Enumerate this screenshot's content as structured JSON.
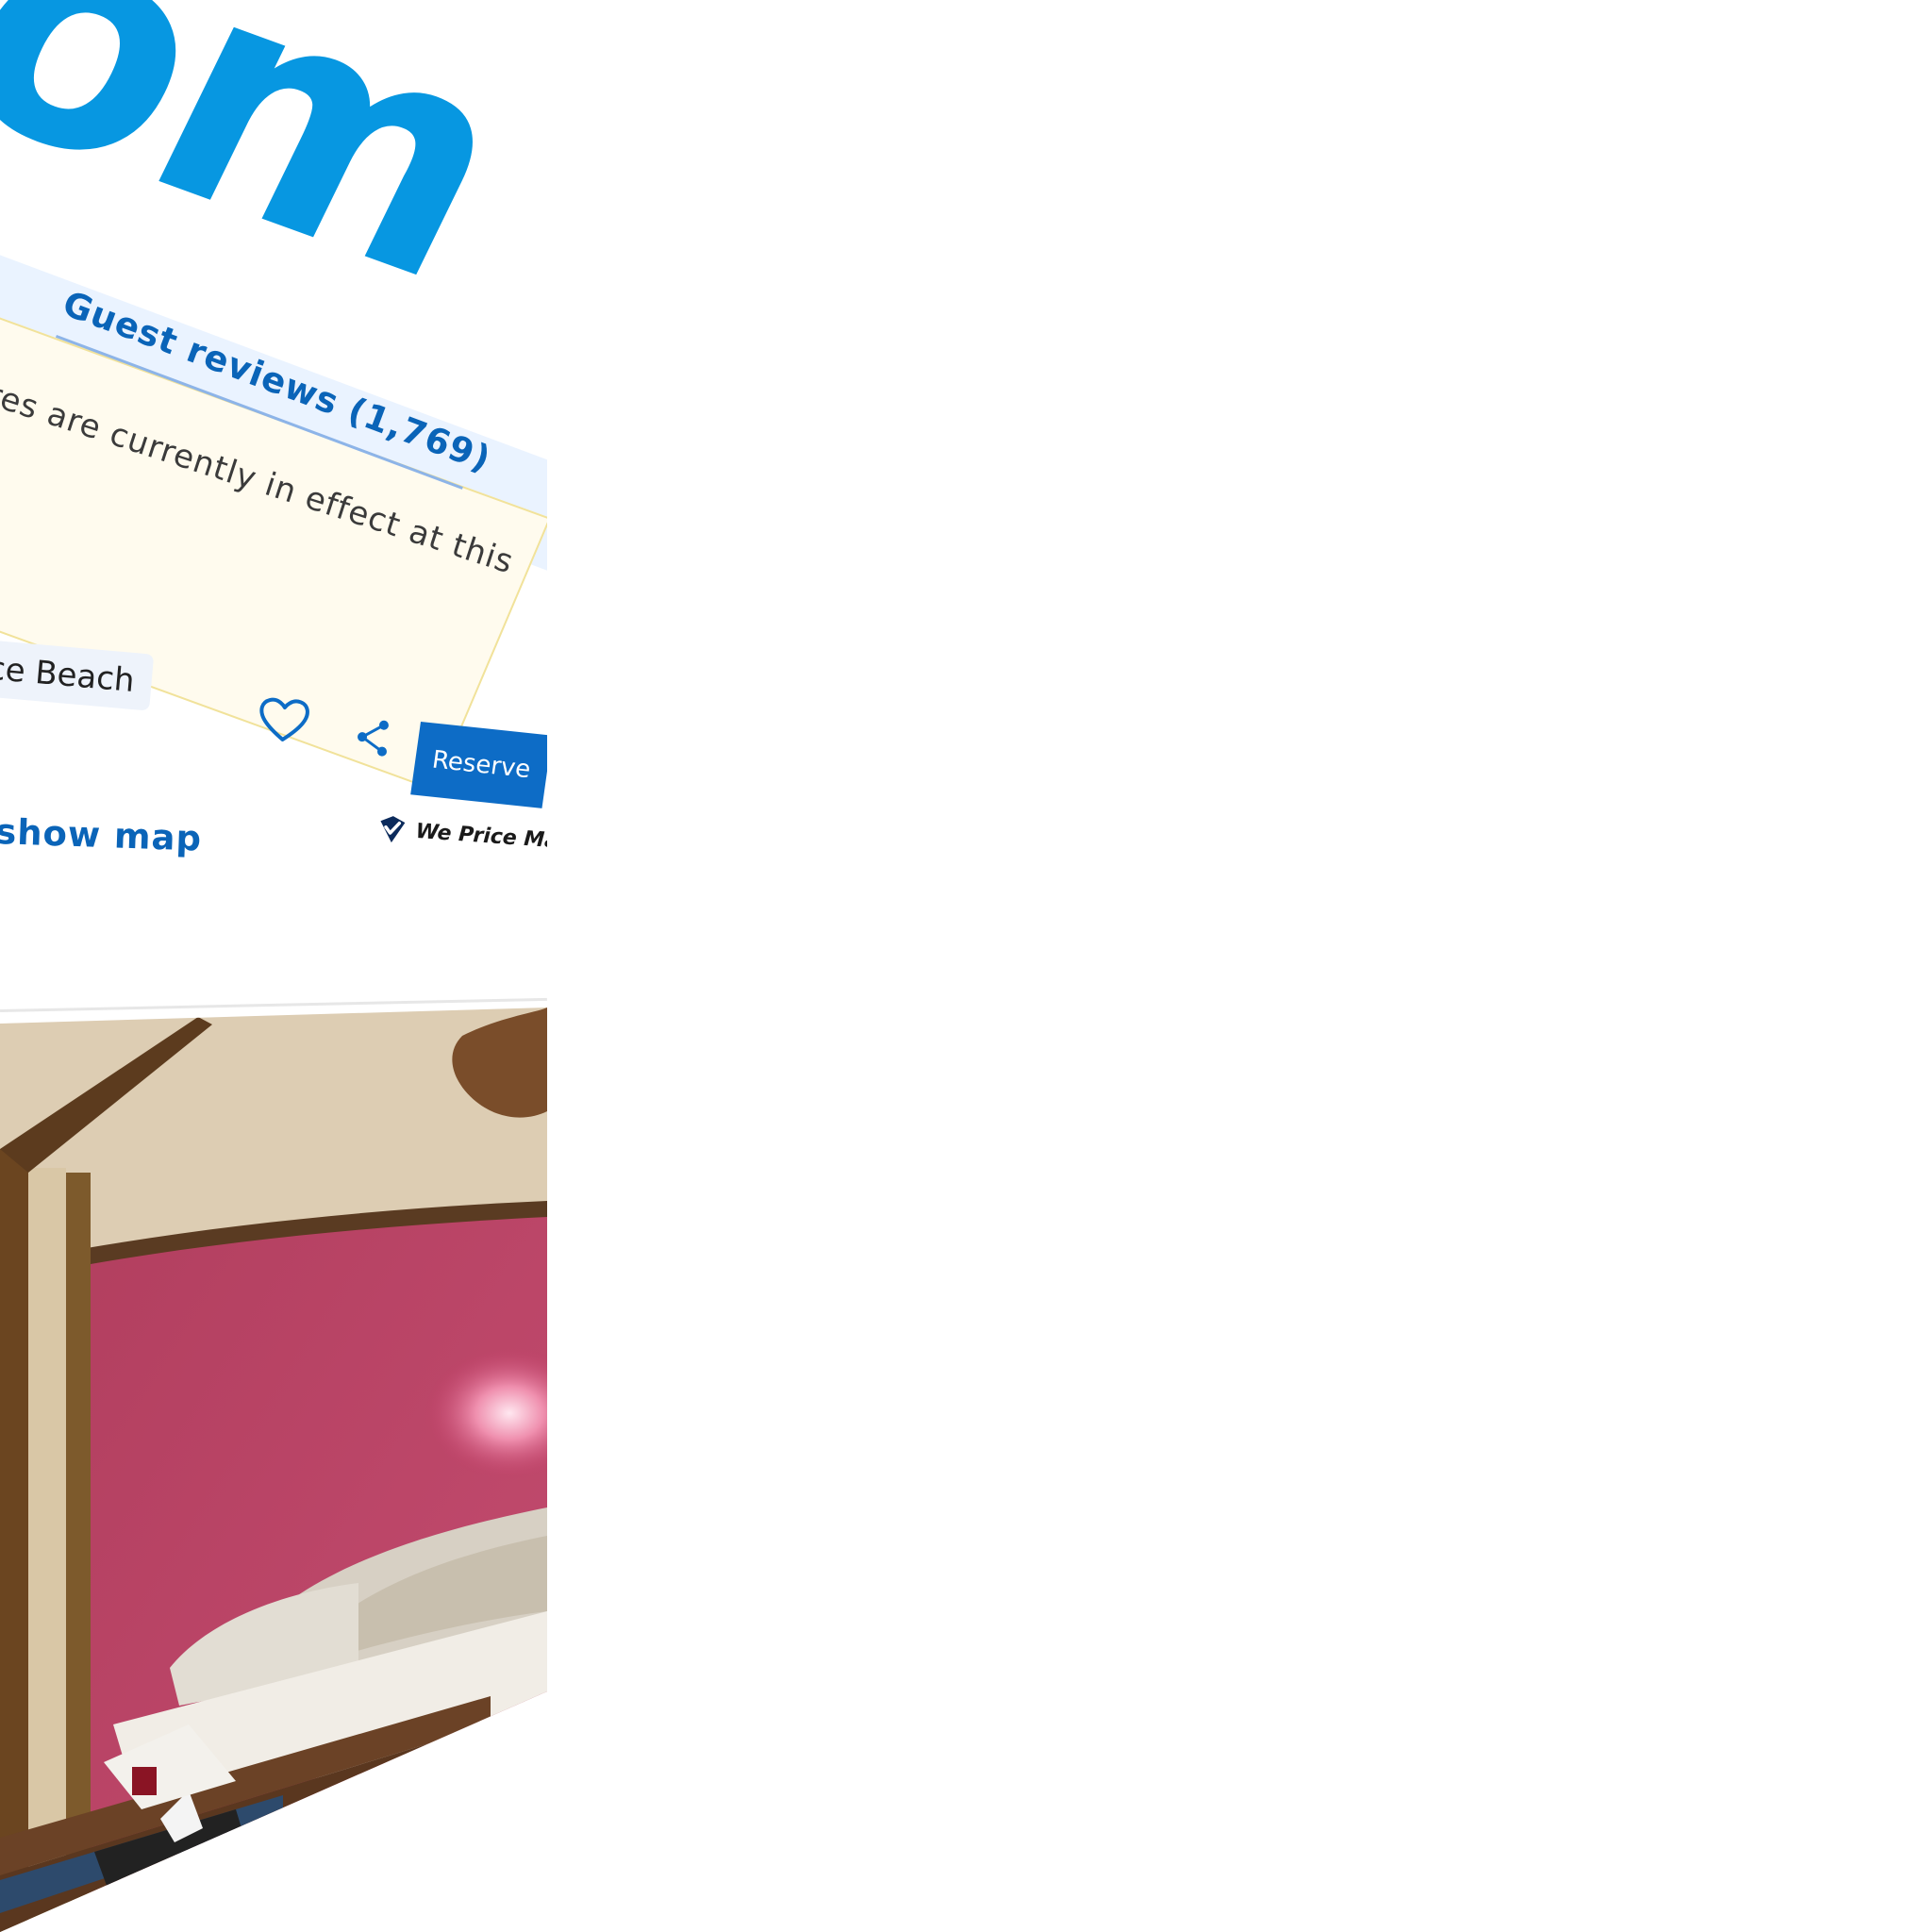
{
  "brand": {
    "wordmark": "com"
  },
  "tabs": {
    "reviews_label": "Guest reviews (1,769)"
  },
  "notice": {
    "text": "res are currently in effect at this"
  },
  "property": {
    "location_chip": "ce Beach",
    "show_map_label": "show map"
  },
  "actions": {
    "reserve_label": "Reserve",
    "price_match_label": "We Price Match"
  },
  "icons": {
    "heart": "heart-icon",
    "share": "share-icon",
    "price_match": "checkmark-shield-icon"
  },
  "colors": {
    "brand_blue": "#0797e1",
    "link_blue": "#0a64b8",
    "button_blue": "#0d6cc6",
    "notice_bg": "#fffbee",
    "tab_bg": "#eaf3ff"
  }
}
